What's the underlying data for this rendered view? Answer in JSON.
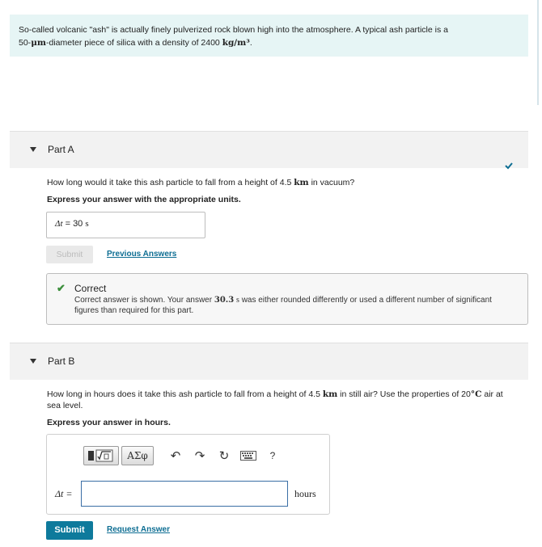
{
  "intro": {
    "line1": "So-called volcanic \"ash\" is actually finely pulverized rock blown high into the atmosphere. A typical ash particle is a",
    "line2_pre": "50-",
    "line2_unit": "μm",
    "line2_post": "-diameter piece of silica with a density of 2400",
    "density_unit": "kg/m³",
    "line2_end": "."
  },
  "part_a": {
    "label": "Part A",
    "question_pre": "How long would it take this ash particle to fall from a height of 4.5",
    "question_unit": "km",
    "question_post": "in vacuum?",
    "instruction": "Express your answer with the appropriate units.",
    "answer_var": "Δt",
    "answer_eq": " =  ",
    "answer_value": "30",
    "answer_unit": "s",
    "submit_label": "Submit",
    "previous_answers_label": "Previous Answers",
    "feedback": {
      "title": "Correct",
      "msg_pre": "Correct answer is shown. Your answer",
      "msg_value": "30.3",
      "msg_unit": "s",
      "msg_post": "was either rounded differently or used a different number of significant figures than required for this part."
    }
  },
  "part_b": {
    "label": "Part B",
    "question_pre": "How long in hours does it take this ash particle to fall from a height of 4.5",
    "question_unit": "km",
    "question_mid": "in still air? Use the properties of 20",
    "question_temp_unit": "°C",
    "question_post": "air at",
    "question_line2": "sea level.",
    "instruction": "Express your answer in hours.",
    "toolbar": {
      "templates_icon": "templates-icon",
      "greek_label": "ΑΣφ",
      "undo_icon": "undo-icon",
      "redo_icon": "redo-icon",
      "reset_icon": "reset-icon",
      "keyboard_icon": "keyboard-icon",
      "help_label": "?"
    },
    "answer_label": "Δt =",
    "answer_value": "",
    "units_label": "hours",
    "submit_label": "Submit",
    "request_answer_label": "Request Answer"
  },
  "colors": {
    "accent": "#0e7a9c",
    "correct": "#3c8f3c",
    "intro_bg": "#e6f5f5"
  }
}
